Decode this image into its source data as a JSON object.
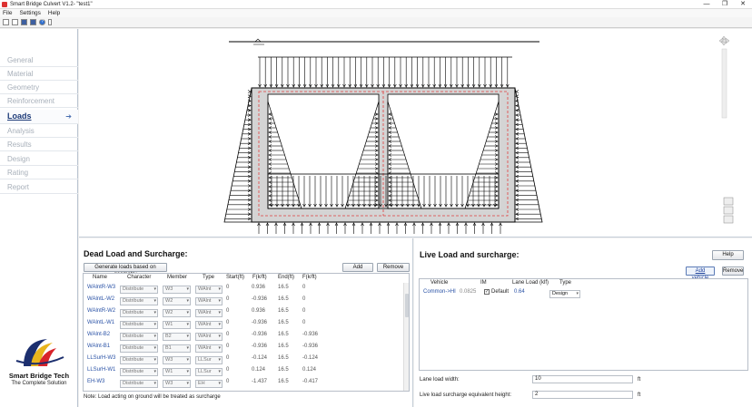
{
  "window": {
    "title": "Smart Bridge Culvert V1.2- \"test1\"",
    "minimize": "—",
    "maximize": "❐",
    "close": "✕"
  },
  "menu": [
    "File",
    "Settings",
    "Help"
  ],
  "sidebar": {
    "items": [
      {
        "label": "General",
        "active": false
      },
      {
        "label": "Material",
        "active": false
      },
      {
        "label": "Geometry",
        "active": false
      },
      {
        "label": "Reinforcement",
        "active": false
      },
      {
        "label": "Loads",
        "active": true
      },
      {
        "label": "Analysis",
        "active": false
      },
      {
        "label": "Results",
        "active": false
      },
      {
        "label": "Design",
        "active": false
      },
      {
        "label": "Rating",
        "active": false
      },
      {
        "label": "Report",
        "active": false
      }
    ],
    "active_arrow": "➔",
    "logo_name": "Smart Bridge Tech",
    "logo_tagline": "The Complete Solution"
  },
  "dead": {
    "title": "Dead Load and Surcharge:",
    "generate_label": "Generate loads based on geometry",
    "add_label": "Add",
    "remove_label": "Remove",
    "columns": [
      "Name",
      "Character",
      "Member",
      "Type",
      "Start(ft)",
      "F(k/ft)",
      "End(ft)",
      "F(k/ft)"
    ],
    "rows": [
      {
        "name": "WAlntR-W3",
        "character": "Distribute",
        "member": "W3",
        "type": "WAlnt",
        "start": "0",
        "fstart": "0.936",
        "end": "16.5",
        "fend": "0"
      },
      {
        "name": "WAlntL-W2",
        "character": "Distribute",
        "member": "W2",
        "type": "WAlnt",
        "start": "0",
        "fstart": "-0.936",
        "end": "16.5",
        "fend": "0"
      },
      {
        "name": "WAlntR-W2",
        "character": "Distribute",
        "member": "W2",
        "type": "WAlnt",
        "start": "0",
        "fstart": "0.936",
        "end": "16.5",
        "fend": "0"
      },
      {
        "name": "WAlntL-W1",
        "character": "Distribute",
        "member": "W1",
        "type": "WAlnt",
        "start": "0",
        "fstart": "-0.936",
        "end": "16.5",
        "fend": "0"
      },
      {
        "name": "WAlnt-B2",
        "character": "Distribute",
        "member": "B2",
        "type": "WAlnt",
        "start": "0",
        "fstart": "-0.936",
        "end": "16.5",
        "fend": "-0.936"
      },
      {
        "name": "WAlnt-B1",
        "character": "Distribute",
        "member": "B1",
        "type": "WAlnt",
        "start": "0",
        "fstart": "-0.936",
        "end": "16.5",
        "fend": "-0.936"
      },
      {
        "name": "LLSurH-W3",
        "character": "Distribute",
        "member": "W3",
        "type": "LLSur",
        "start": "0",
        "fstart": "-0.124",
        "end": "16.5",
        "fend": "-0.124"
      },
      {
        "name": "LLSurH-W1",
        "character": "Distribute",
        "member": "W1",
        "type": "LLSur",
        "start": "0",
        "fstart": "0.124",
        "end": "16.5",
        "fend": "0.124"
      },
      {
        "name": "EH-W3",
        "character": "Distribute",
        "member": "W3",
        "type": "EH",
        "start": "0",
        "fstart": "-1.437",
        "end": "16.5",
        "fend": "-0.417"
      }
    ],
    "note": "Note: Load acting on ground will be treated as surcharge"
  },
  "live": {
    "title": "Live Load and surcharge:",
    "help_label": "Help",
    "add_vehicle_label": "Add vehicle",
    "remove_label": "Remove",
    "columns": [
      "Vehicle",
      "IM",
      "Lane Load (klf)",
      "Type"
    ],
    "rows": [
      {
        "vehicle": "Common->HI",
        "im": "0.0825",
        "default_label": "Default",
        "default_checked": true,
        "lane_load": "0.64",
        "type": "Design"
      }
    ],
    "lane_width_label": "Lane load width:",
    "lane_width_value": "10",
    "lane_width_unit": "ft",
    "surcharge_label": "Live load surcharge equivalent height:",
    "surcharge_value": "2",
    "surcharge_unit": "ft"
  },
  "colors": {
    "accent": "#1c3a78",
    "dashed_center": "#e04040",
    "panel_border": "#c5ced8"
  },
  "icons": [
    "new-file-icon",
    "open-icon",
    "save-icon",
    "save-as-icon",
    "help-icon",
    "print-icon"
  ]
}
